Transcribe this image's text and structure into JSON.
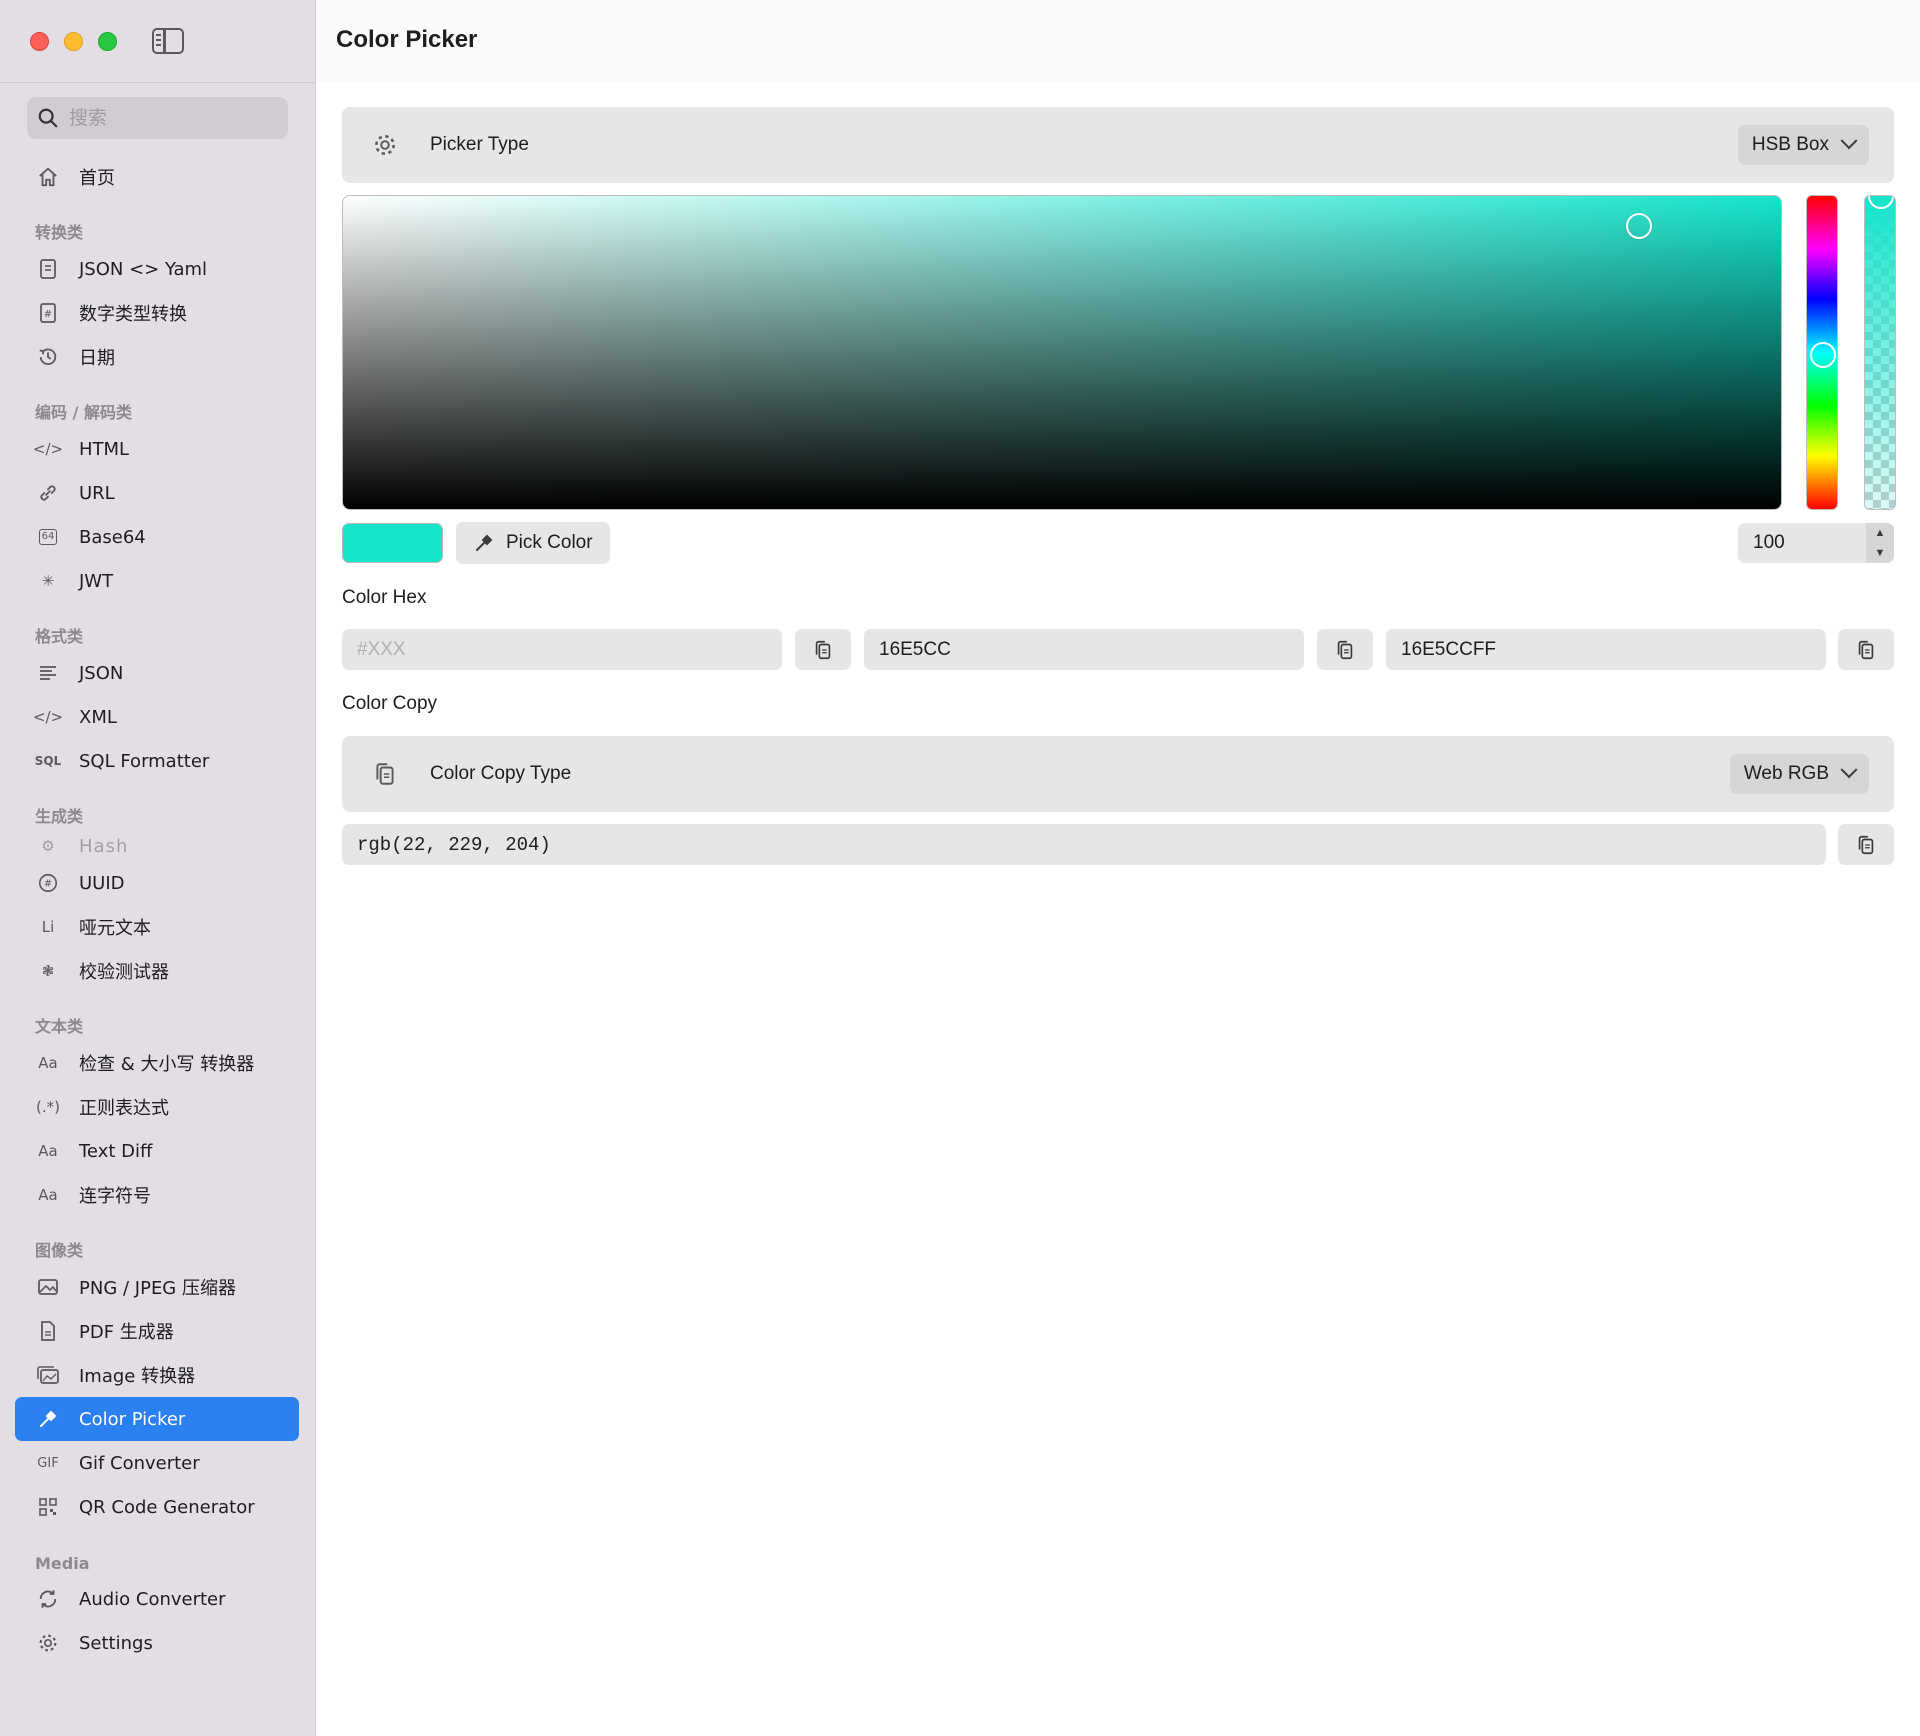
{
  "sidebar": {
    "search_placeholder": "搜索",
    "home": "首页",
    "sections": {
      "convert": "转换类",
      "encode": "编码 / 解码类",
      "format": "格式类",
      "generate": "生成类",
      "text": "文本类",
      "image": "图像类",
      "media": "Media"
    },
    "items": {
      "json_yaml": "JSON <> Yaml",
      "number_convert": "数字类型转换",
      "date": "日期",
      "html": "HTML",
      "url": "URL",
      "base64": "Base64",
      "jwt": "JWT",
      "json": "JSON",
      "xml": "XML",
      "sql": "SQL Formatter",
      "hash": "Hash",
      "uuid": "UUID",
      "lorem": "哑元文本",
      "checksum": "校验测试器",
      "case": "检查 & 大小写 转换器",
      "regex": "正则表达式",
      "text_diff": "Text Diff",
      "hyphen": "连字符号",
      "png_jpeg": "PNG / JPEG 压缩器",
      "pdf": "PDF 生成器",
      "image_convert": "Image 转换器",
      "color_picker": "Color Picker",
      "gif": "Gif Converter",
      "qr": "QR Code Generator",
      "audio": "Audio Converter",
      "settings": "Settings"
    },
    "icon_text": {
      "sql": "SQL",
      "lorem": "Li",
      "aa": "Aa",
      "regex": "(.*)",
      "gif": "GIF",
      "html": "</>",
      "xml": "</>",
      "base64": "64"
    }
  },
  "main": {
    "title": "Color Picker",
    "picker_type_label": "Picker Type",
    "picker_type_value": "HSB Box",
    "pick_color_label": "Pick Color",
    "alpha_value": "100",
    "color_hex_label": "Color Hex",
    "hex_short_placeholder": "#XXX",
    "hex_value": "16E5CC",
    "hex_alpha_value": "16E5CCFF",
    "color_copy_label": "Color Copy",
    "color_copy_type_label": "Color Copy Type",
    "color_copy_type_value": "Web RGB",
    "rgb_output": "rgb(22, 229, 204)"
  },
  "colors": {
    "selected": "#16E5CC",
    "accent": "#2a7ff1"
  }
}
